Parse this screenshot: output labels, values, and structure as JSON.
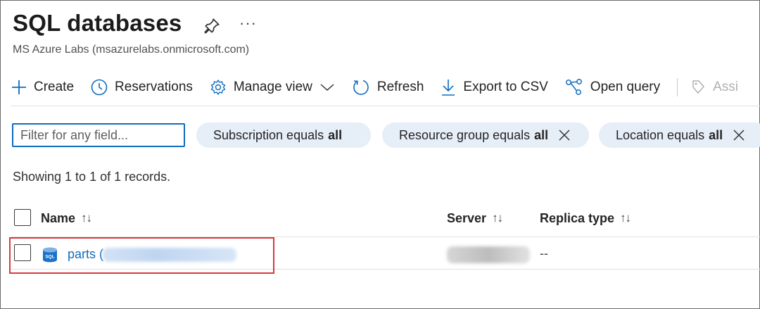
{
  "header": {
    "title": "SQL databases",
    "subtitle": "MS Azure Labs (msazurelabs.onmicrosoft.com)",
    "more_label": "···"
  },
  "toolbar": {
    "items": [
      {
        "label": "Create",
        "icon": "plus-icon"
      },
      {
        "label": "Reservations",
        "icon": "clock-icon"
      },
      {
        "label": "Manage view",
        "icon": "gear-icon"
      },
      {
        "label": "Refresh",
        "icon": "refresh-icon"
      },
      {
        "label": "Export to CSV",
        "icon": "download-icon"
      },
      {
        "label": "Open query",
        "icon": "query-icon"
      },
      {
        "label": "Assi",
        "icon": "tag-icon",
        "disabled": true
      }
    ]
  },
  "filters": {
    "placeholder": "Filter for any field...",
    "pills": [
      {
        "text": "Subscription equals",
        "value": "all"
      },
      {
        "text": "Resource group equals",
        "value": "all"
      },
      {
        "text": "Location equals",
        "value": "all"
      }
    ]
  },
  "records_text": "Showing 1 to 1 of 1 records.",
  "table": {
    "columns": [
      {
        "label": "Name",
        "sort": "↑↓"
      },
      {
        "label": "Server",
        "sort": "↑↓"
      },
      {
        "label": "Replica type",
        "sort": "↑↓"
      }
    ],
    "rows": [
      {
        "name": "parts",
        "name_suffix": "(",
        "replica": "--"
      }
    ]
  },
  "colors": {
    "accent": "#0f6cbd",
    "highlight": "#d63b3b",
    "pill_bg": "#e6eef8"
  }
}
